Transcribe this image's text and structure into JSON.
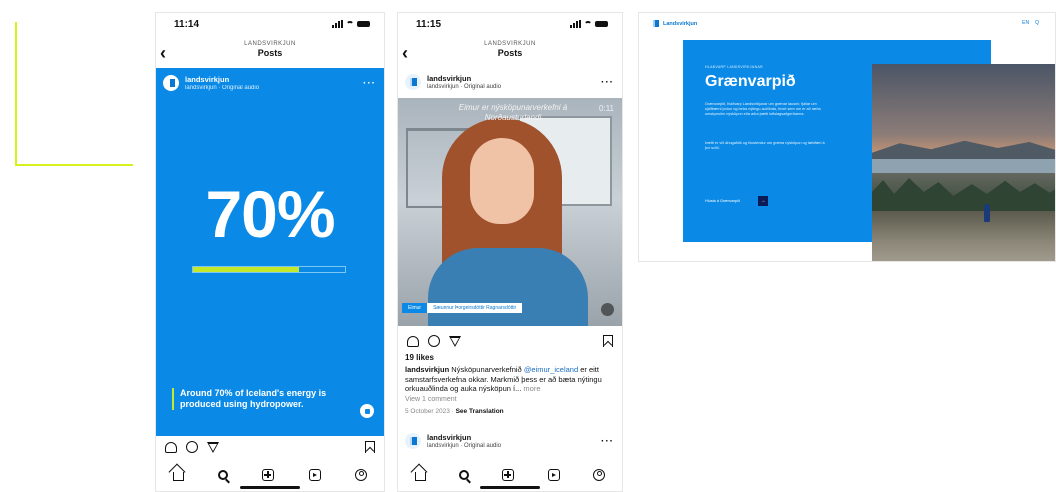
{
  "phone1": {
    "status_time": "11:14",
    "nav_sub": "LANDSVIRKJUN",
    "nav_title": "Posts",
    "account": "landsvirkjun",
    "audio": "landsvirkjun · Original audio",
    "big_stat": "70%",
    "progress_fraction": 0.7,
    "caption": "Around 70% of Iceland's energy is produced using hydropower."
  },
  "phone2": {
    "status_time": "11:15",
    "nav_sub": "LANDSVIRKJUN",
    "nav_title": "Posts",
    "account": "landsvirkjun",
    "audio": "landsvirkjun · Original audio",
    "video_caption": "Eimur er nýsköpunarverkefni á Norðausturlandi",
    "video_time": "0:11",
    "lower_third_name": "Eimur",
    "lower_third_role": "Sæunnur Þorgeirsdóttir Ragnarsdóttir",
    "likes": "19 likes",
    "caption_user": "landsvirkjun",
    "caption_text_1": " Nýsköpunarverkefnið ",
    "caption_mention": "@eimur_iceland",
    "caption_text_2": " er eitt samstarfsverkefna okkar. Markmið þess er að bæta nýtingu orkuauðlinda og auka nýsköpun í...",
    "caption_more": " more",
    "view_comments": "View 1 comment",
    "date": "5 October 2023",
    "see_translation": "See Translation",
    "next_account": "landsvirkjun",
    "next_audio": "landsvirkjun · Original audio"
  },
  "website": {
    "logo": "Landsvirkjun",
    "menu": [
      "EN",
      "Q"
    ],
    "eyebrow": "HLAÐVARP LANDSVIRKJUNAR",
    "title": "Grænvarpið",
    "paragraph_1": "Grænvarpið, hlaðvarp Landsvirkjunar um grænar lausnir, fjallar um sjálfbærni þróun og betra nýtingu auðlinda, hvort sem um er að ræða umskynsöm nýsköpun eða aðra þætti loftslagsaðgerðanna.",
    "paragraph_2": "Þætti er við áhugafólk og hlustendur um græna nýsköpun og tækifæri á því sviði.",
    "cta_label": "Hlusta á Grænvarpið",
    "cta_icon": "→"
  },
  "colors": {
    "brand_blue": "#0a8ae6",
    "accent_lime": "#c4e82a",
    "bracket": "#d6f21a",
    "dark_navy": "#0b1b57"
  }
}
